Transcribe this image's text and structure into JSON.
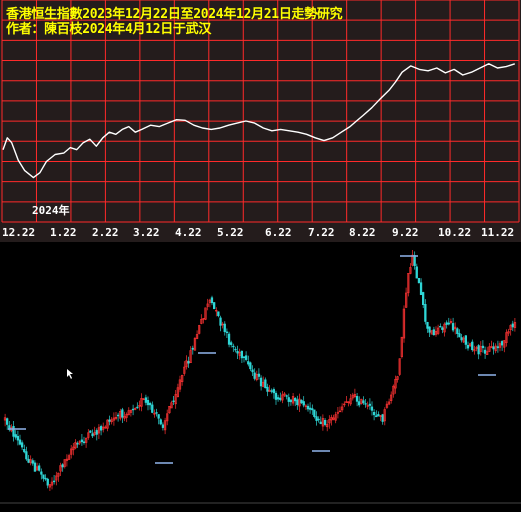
{
  "header": {
    "title": "香港恒生指數2023年12月22日至2024年12月21日走勢研究",
    "author_line": "作者：陳百枝2024年4月12日于武汉"
  },
  "colors": {
    "top_background": "#241c1c",
    "grid": "#ff2a2a",
    "curve": "#ffffff",
    "title_text": "#ffff00",
    "month_label": "#ffffff",
    "candle_up": "#ff3333",
    "candle_down": "#2fd6d6",
    "bottom_background": "#000000",
    "annotation": "#88aadd"
  },
  "chart_data": [
    {
      "type": "line",
      "title": "香港恒生指數2023年12月22日至2024年12月21日走勢研究",
      "x_tick_labels": [
        "12.22",
        "1.22",
        "2.22",
        "3.22",
        "4.22",
        "5.22",
        "6.22",
        "7.22",
        "8.22",
        "9.22",
        "10.22",
        "11.22"
      ],
      "year_annotation": "2024年",
      "grid": true,
      "note": "forecast trend curve, no y-axis values printed",
      "series": [
        {
          "x": [
            0,
            0.1,
            0.2,
            0.35,
            0.5,
            0.7,
            0.85,
            1.0,
            1.2,
            1.4,
            1.55,
            1.7,
            1.85,
            2.0,
            2.15,
            2.3,
            2.45,
            2.6,
            2.75,
            2.9,
            3.05,
            3.2,
            3.4,
            3.6,
            3.8,
            4.0,
            4.2,
            4.4,
            4.6,
            4.8,
            5.0,
            5.2,
            5.4,
            5.6,
            5.8,
            6.0,
            6.2,
            6.4,
            6.6,
            6.8,
            7.0,
            7.2,
            7.4,
            7.6,
            7.8,
            8.0,
            8.15,
            8.3,
            8.5,
            8.7,
            8.9,
            9.05,
            9.2,
            9.4,
            9.6,
            9.8,
            10.0,
            10.2,
            10.4,
            10.6,
            10.8,
            11.0,
            11.2,
            11.4,
            11.6,
            11.8
          ],
          "y": [
            0.45,
            0.62,
            0.55,
            0.3,
            0.15,
            0.05,
            0.12,
            0.28,
            0.38,
            0.4,
            0.48,
            0.45,
            0.55,
            0.6,
            0.5,
            0.62,
            0.7,
            0.67,
            0.74,
            0.78,
            0.7,
            0.74,
            0.8,
            0.78,
            0.83,
            0.88,
            0.87,
            0.8,
            0.76,
            0.74,
            0.76,
            0.8,
            0.83,
            0.86,
            0.83,
            0.76,
            0.72,
            0.74,
            0.72,
            0.7,
            0.67,
            0.62,
            0.58,
            0.62,
            0.7,
            0.78,
            0.86,
            0.94,
            1.05,
            1.18,
            1.3,
            1.42,
            1.56,
            1.65,
            1.6,
            1.58,
            1.62,
            1.55,
            1.6,
            1.52,
            1.56,
            1.62,
            1.68,
            1.62,
            1.64,
            1.68
          ]
        }
      ]
    },
    {
      "type": "candlestick",
      "title": "",
      "note": "historical candlestick chart, no axis values legible",
      "series": [
        {
          "name": "",
          "ohlc_count": 240
        }
      ]
    }
  ]
}
